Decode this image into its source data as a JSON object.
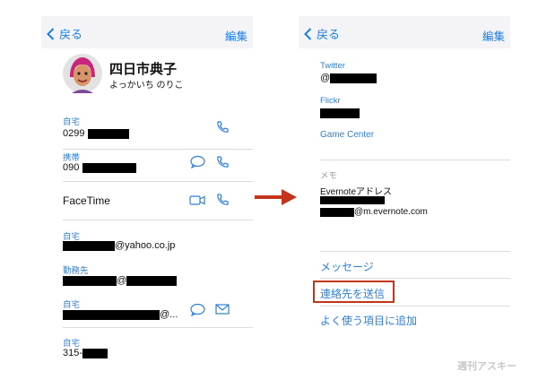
{
  "left": {
    "nav": {
      "back": "戻る",
      "edit": "編集"
    },
    "contact": {
      "name": "四日市典子",
      "reading": "よっかいち のりこ"
    },
    "phones": [
      {
        "label": "自宅",
        "value": "0299"
      },
      {
        "label": "携帯",
        "value": "090"
      }
    ],
    "facetime": "FaceTime",
    "emails": [
      {
        "label": "自宅",
        "suffix": "@yahoo.co.jp"
      },
      {
        "label": "勤務先",
        "suffix": "@"
      },
      {
        "label": "自宅",
        "suffix": "@..."
      }
    ],
    "postal": {
      "label": "自宅",
      "value": "315-"
    }
  },
  "right": {
    "nav": {
      "back": "戻る",
      "edit": "編集"
    },
    "twitter": {
      "label": "Twitter",
      "value": "@"
    },
    "flickr": {
      "label": "Flickr"
    },
    "game_center": "Game Center",
    "memo": {
      "label": "メモ",
      "line1": "Evernoteアドレス",
      "line3_suffix": "@m.evernote.com"
    },
    "actions": {
      "message": "メッセージ",
      "send_contact": "連絡先を送信",
      "add_favorite": "よく使う項目に追加"
    }
  },
  "watermark": "週刊アスキー",
  "colors": {
    "accent": "#2f7fd6",
    "highlight": "#c2341c",
    "arrow": "#c2341c",
    "redaction": "#000000"
  }
}
